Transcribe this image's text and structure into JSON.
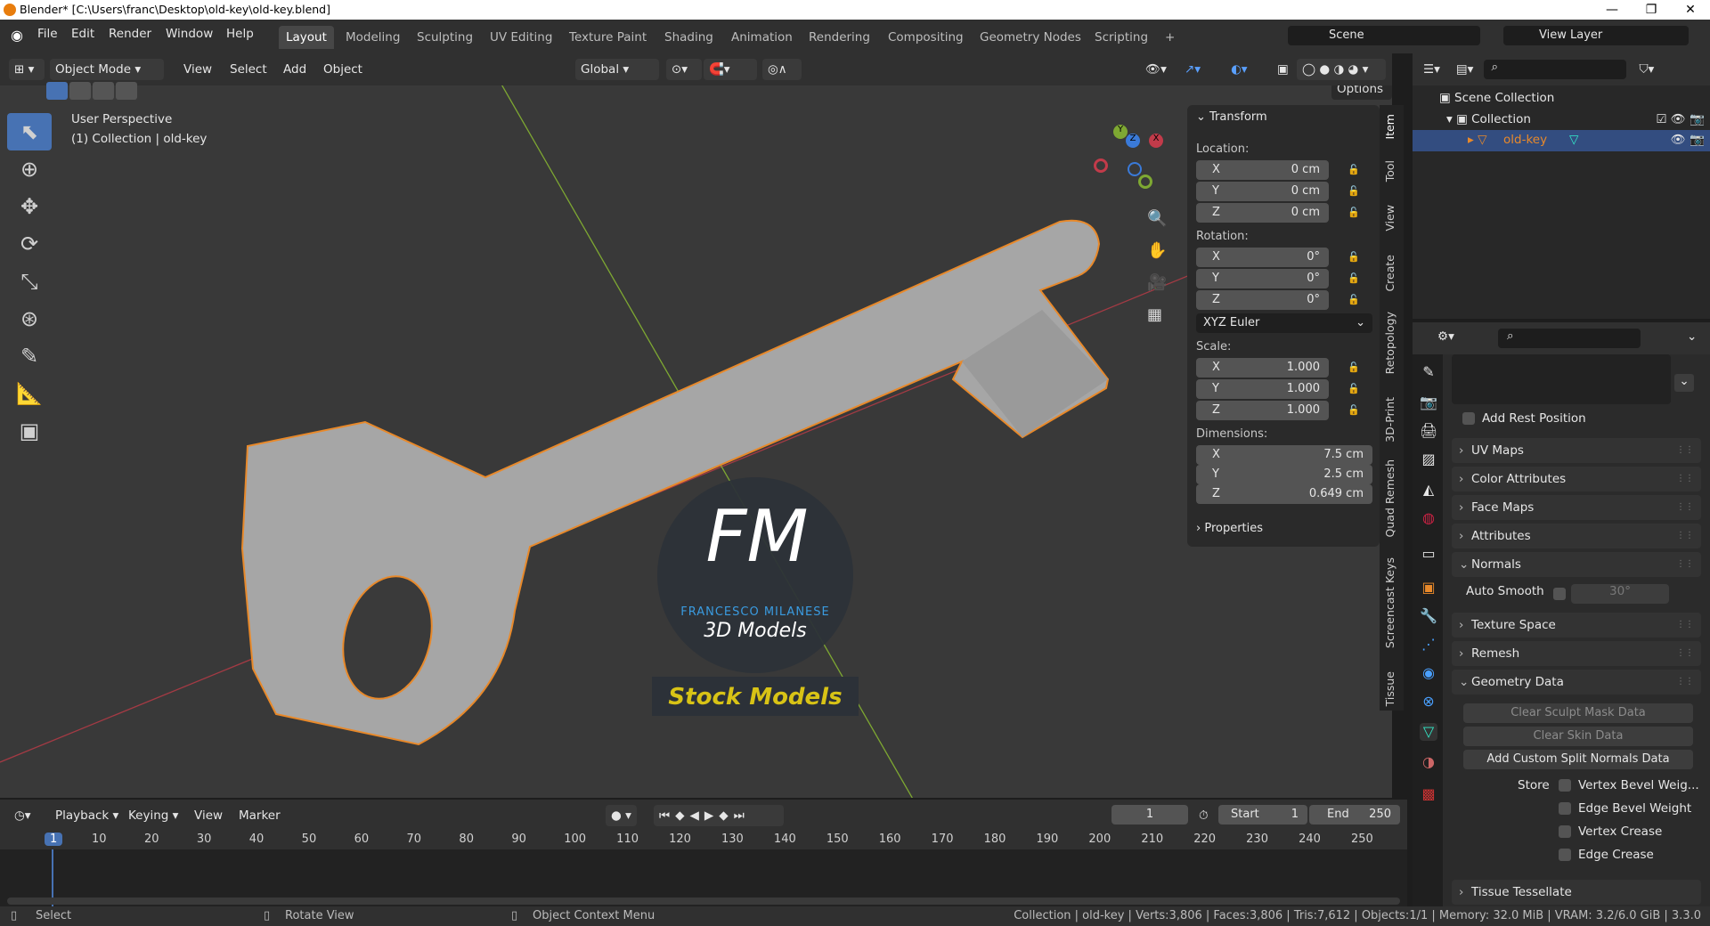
{
  "titlebar": {
    "title": "Blender* [C:\\Users\\franc\\Desktop\\old-key\\old-key.blend]",
    "min": "—",
    "max": "❐",
    "close": "✕"
  },
  "menu": [
    "File",
    "Edit",
    "Render",
    "Window",
    "Help"
  ],
  "workspaces": [
    "Layout",
    "Modeling",
    "Sculpting",
    "UV Editing",
    "Texture Paint",
    "Shading",
    "Animation",
    "Rendering",
    "Compositing",
    "Geometry Nodes",
    "Scripting",
    "+"
  ],
  "scene": {
    "label": "Scene",
    "view_layer": "View Layer"
  },
  "header3d": {
    "mode": "Object Mode",
    "view": "View",
    "select": "Select",
    "add": "Add",
    "object": "Object",
    "orientation": "Global",
    "options": "Options"
  },
  "viewport": {
    "perspective": "User Perspective",
    "collection_line": "(1) Collection | old-key"
  },
  "watermark": {
    "initials": "FM",
    "name": "FRANCESCO MILANESE",
    "subtitle": "3D Models",
    "banner": "Stock Models"
  },
  "gizmo": {
    "x": "X",
    "y": "Y",
    "z": "Z"
  },
  "npanel": {
    "transform": "Transform",
    "location": "Location:",
    "rotation": "Rotation:",
    "scale": "Scale:",
    "dimensions": "Dimensions:",
    "rotation_mode": "XYZ Euler",
    "properties": "Properties",
    "loc": [
      {
        "a": "X",
        "v": "0 cm"
      },
      {
        "a": "Y",
        "v": "0 cm"
      },
      {
        "a": "Z",
        "v": "0 cm"
      }
    ],
    "rot": [
      {
        "a": "X",
        "v": "0°"
      },
      {
        "a": "Y",
        "v": "0°"
      },
      {
        "a": "Z",
        "v": "0°"
      }
    ],
    "scl": [
      {
        "a": "X",
        "v": "1.000"
      },
      {
        "a": "Y",
        "v": "1.000"
      },
      {
        "a": "Z",
        "v": "1.000"
      }
    ],
    "dim": [
      {
        "a": "X",
        "v": "7.5 cm"
      },
      {
        "a": "Y",
        "v": "2.5 cm"
      },
      {
        "a": "Z",
        "v": "0.649 cm"
      }
    ]
  },
  "sidetabs": [
    "Item",
    "Tool",
    "View",
    "Create",
    "Retopology",
    "3D-Print",
    "Quad Remesh",
    "Screencast Keys",
    "Tissue"
  ],
  "outliner": {
    "scene_collection": "Scene Collection",
    "collection": "Collection",
    "object": "old-key"
  },
  "properties": {
    "add_rest_position": "Add Rest Position",
    "uv_maps": "UV Maps",
    "color_attributes": "Color Attributes",
    "face_maps": "Face Maps",
    "attributes": "Attributes",
    "normals": "Normals",
    "auto_smooth": "Auto Smooth",
    "angle": "30°",
    "texture_space": "Texture Space",
    "remesh": "Remesh",
    "geometry_data": "Geometry Data",
    "clear_sculpt": "Clear Sculpt Mask Data",
    "clear_skin": "Clear Skin Data",
    "add_split": "Add Custom Split Normals Data",
    "store": "Store",
    "vbw": "Vertex Bevel Weig...",
    "ebw": "Edge Bevel Weight",
    "vc": "Vertex Crease",
    "ec": "Edge Crease",
    "tissue": "Tissue Tessellate"
  },
  "timeline": {
    "playback": "Playback",
    "keying": "Keying",
    "view": "View",
    "marker": "Marker",
    "current": "1",
    "start_label": "Start",
    "start": "1",
    "end_label": "End",
    "end": "250",
    "ticks": [
      "1",
      "10",
      "20",
      "30",
      "40",
      "50",
      "60",
      "70",
      "80",
      "90",
      "100",
      "110",
      "120",
      "130",
      "140",
      "150",
      "160",
      "170",
      "180",
      "190",
      "200",
      "210",
      "220",
      "230",
      "240",
      "250"
    ]
  },
  "status": {
    "select": "Select",
    "rotate": "Rotate View",
    "context": "Object Context Menu",
    "info": "Collection | old-key | Verts:3,806 | Faces:3,806 | Tris:7,612 | Objects:1/1 | Memory: 32.0 MiB | VRAM: 3.2/6.0 GiB | 3.3.0"
  },
  "colors": {
    "accent": "#4772b3",
    "selection": "#e8892a",
    "x_axis": "#c23b4a",
    "y_axis": "#7ea832"
  }
}
